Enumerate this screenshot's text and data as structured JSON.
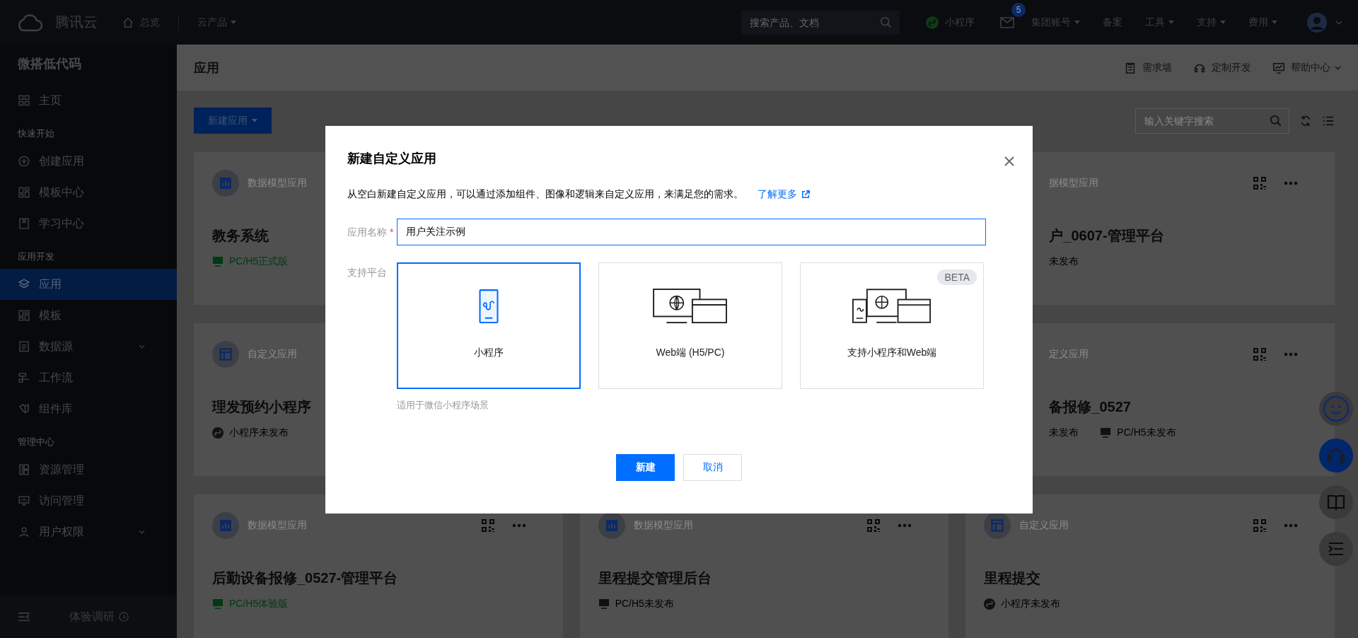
{
  "topbar": {
    "brand": "腾讯云",
    "home": "总览",
    "products": "云产品",
    "search": {
      "placeholder": "搜索产品、文档"
    },
    "miniprogram": "小程序",
    "mail_badge": "5",
    "menus": [
      {
        "label": "集团账号",
        "kind": "menu"
      },
      {
        "label": "备案",
        "kind": "link"
      },
      {
        "label": "工具",
        "kind": "menu"
      },
      {
        "label": "支持",
        "kind": "menu"
      },
      {
        "label": "费用",
        "kind": "menu"
      }
    ]
  },
  "sidebar": {
    "title": "微搭低代码",
    "groups": [
      {
        "items": [
          {
            "label": "主页",
            "kind": "link",
            "selected": false
          }
        ]
      },
      {
        "heading": "快速开始",
        "items": [
          {
            "label": "创建应用",
            "kind": "link",
            "selected": false
          },
          {
            "label": "模板中心",
            "kind": "link",
            "selected": false
          },
          {
            "label": "学习中心",
            "kind": "link",
            "selected": false
          }
        ]
      },
      {
        "heading": "应用开发",
        "items": [
          {
            "label": "应用",
            "kind": "link",
            "selected": true
          },
          {
            "label": "模板",
            "kind": "link",
            "selected": false
          },
          {
            "label": "数据源",
            "kind": "group",
            "selected": false
          },
          {
            "label": "工作流",
            "kind": "link",
            "selected": false
          },
          {
            "label": "组件库",
            "kind": "link",
            "selected": false
          }
        ]
      },
      {
        "heading": "管理中心",
        "items": [
          {
            "label": "资源管理",
            "kind": "link",
            "selected": false
          },
          {
            "label": "访问管理",
            "kind": "link",
            "selected": false
          },
          {
            "label": "用户权限",
            "kind": "group",
            "selected": false
          }
        ]
      }
    ],
    "footer": "体验调研"
  },
  "header": {
    "title": "应用",
    "links": [
      "需求墙",
      "定制开发",
      "帮助中心"
    ]
  },
  "toolbar": {
    "new_button": "新建应用",
    "search": {
      "placeholder": "输入关键字搜索"
    }
  },
  "card_rows": [
    [
      {
        "kind": "data_model",
        "type": "数据模型应用",
        "title": "教务系统",
        "statuses": [
          {
            "kind": "pc",
            "text": "PC/H5正式版",
            "published": true
          }
        ]
      },
      {
        "type": "据模型应用",
        "title": "户_0607-管理平台",
        "statuses": [
          {
            "kind": "none",
            "text": "未发布",
            "published": false
          }
        ]
      }
    ],
    [
      {
        "kind": "custom",
        "type": "自定义应用",
        "title": "理发预约小程序",
        "statuses": [
          {
            "kind": "mini",
            "text": "小程序未发布",
            "published": false
          }
        ]
      },
      {
        "type": "定义应用",
        "title": "备报修_0527",
        "statuses": [
          {
            "kind": "none",
            "text": "未发布",
            "published": false
          },
          {
            "kind": "pc",
            "text": "PC/H5未发布",
            "published": false
          }
        ]
      }
    ],
    [
      {
        "kind": "data_model",
        "type": "数据模型应用",
        "title": "后勤设备报修_0527-管理平台",
        "statuses": [
          {
            "kind": "pc",
            "text": "PC/H5体验版",
            "published": true
          }
        ]
      },
      {
        "kind": "data_model",
        "type": "数据模型应用",
        "title": "里程提交管理后台",
        "statuses": [
          {
            "kind": "pc",
            "text": "PC/H5未发布",
            "published": false
          }
        ]
      },
      {
        "kind": "custom",
        "type": "自定义应用",
        "title": "里程提交",
        "statuses": [
          {
            "kind": "mini",
            "text": "小程序未发布",
            "published": false
          }
        ]
      }
    ]
  ],
  "dialog": {
    "title": "新建自定义应用",
    "description": "从空白新建自定义应用，可以通过添加组件、图像和逻辑来自定义应用，来满足您的需求。",
    "link": "了解更多",
    "name_label": "应用名称",
    "required_mark": "*",
    "name_value": "用户关注示例",
    "platform_label": "支持平台",
    "options": [
      {
        "kind": "mini",
        "label": "小程序",
        "selected": true
      },
      {
        "kind": "web",
        "label": "Web端 (H5/PC)",
        "selected": false
      },
      {
        "kind": "both",
        "label": "支持小程序和Web端",
        "selected": false,
        "badge": "BETA"
      }
    ],
    "hint": "适用于微信小程序场景",
    "buttons": [
      {
        "label": "新建",
        "kind": "primary"
      },
      {
        "label": "取消",
        "kind": "secondary"
      }
    ]
  }
}
